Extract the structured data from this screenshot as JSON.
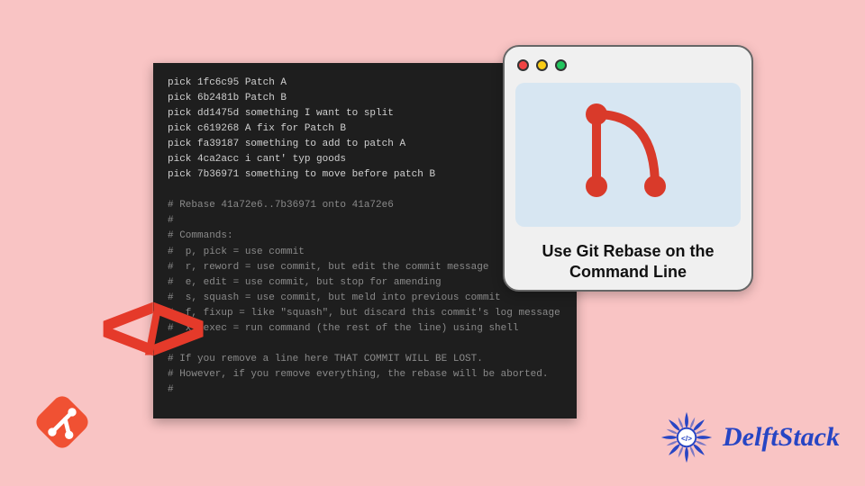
{
  "terminal": {
    "lines": [
      "pick 1fc6c95 Patch A",
      "pick 6b2481b Patch B",
      "pick dd1475d something I want to split",
      "pick c619268 A fix for Patch B",
      "pick fa39187 something to add to patch A",
      "pick 4ca2acc i cant' typ goods",
      "pick 7b36971 something to move before patch B",
      "",
      "# Rebase 41a72e6..7b36971 onto 41a72e6",
      "#",
      "# Commands:",
      "#  p, pick = use commit",
      "#  r, reword = use commit, but edit the commit message",
      "#  e, edit = use commit, but stop for amending",
      "#  s, squash = use commit, but meld into previous commit",
      "#  f, fixup = like \"squash\", but discard this commit's log message",
      "#  x, exec = run command (the rest of the line) using shell",
      "#",
      "# If you remove a line here THAT COMMIT WILL BE LOST.",
      "# However, if you remove everything, the rebase will be aborted.",
      "#"
    ]
  },
  "card": {
    "caption": "Use Git Rebase on the Command Line"
  },
  "brand": {
    "name": "DelftStack"
  },
  "icons": {
    "code_bracket": "</>",
    "git": "git-icon",
    "branch": "branch-icon",
    "mandala": "mandala-icon"
  },
  "colors": {
    "bg": "#f9c4c4",
    "terminal_bg": "#1e1e1e",
    "accent_red": "#e53a2a",
    "card_body": "#d7e6f2",
    "brand_blue": "#2745c4"
  }
}
